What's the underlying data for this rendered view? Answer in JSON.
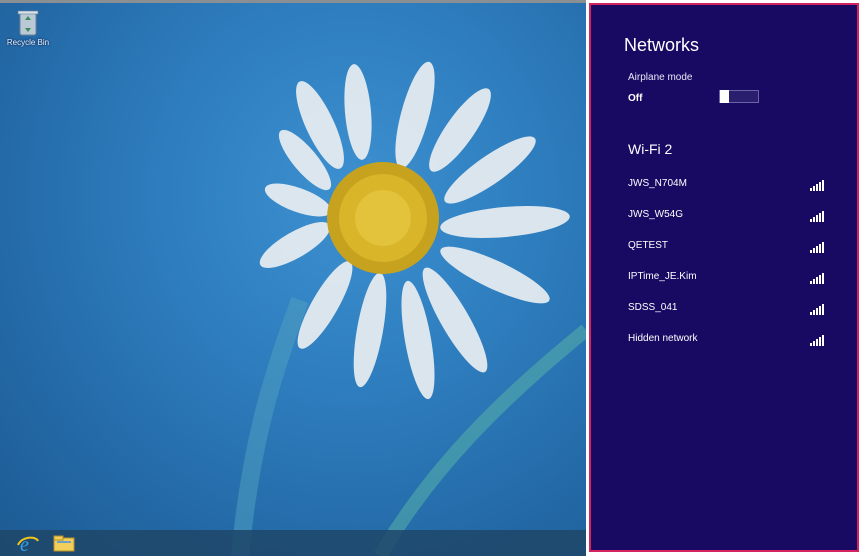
{
  "desktop": {
    "recycle_bin": {
      "label": "Recycle Bin",
      "icon": "recycle-bin-icon"
    },
    "taskbar": {
      "items": [
        {
          "name": "internet-explorer",
          "icon": "ie-icon"
        },
        {
          "name": "file-explorer",
          "icon": "folder-icon"
        }
      ]
    }
  },
  "networks_panel": {
    "title": "Networks",
    "airplane_mode": {
      "label": "Airplane mode",
      "state": "Off"
    },
    "section_title": "Wi-Fi 2",
    "networks": [
      {
        "name": "JWS_N704M",
        "signal_icon": "wifi-signal-icon"
      },
      {
        "name": "JWS_W54G",
        "signal_icon": "wifi-signal-icon"
      },
      {
        "name": "QETEST",
        "signal_icon": "wifi-signal-icon"
      },
      {
        "name": "IPTime_JE.Kim",
        "signal_icon": "wifi-signal-icon"
      },
      {
        "name": "SDSS_041",
        "signal_icon": "wifi-signal-icon"
      },
      {
        "name": "Hidden network",
        "signal_icon": "wifi-signal-icon"
      }
    ],
    "colors": {
      "background": "#180a63",
      "border": "#d4225f",
      "desktop": "#2f7fc0"
    }
  }
}
